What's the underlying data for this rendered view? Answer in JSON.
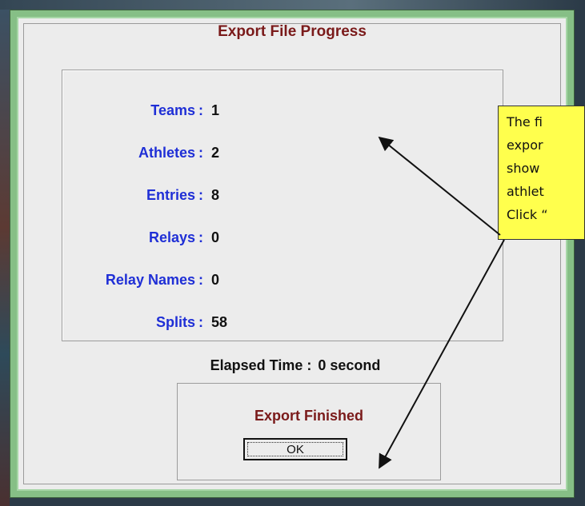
{
  "dialog": {
    "title": "Export File Progress",
    "stats": [
      {
        "label": "Teams",
        "colon": ":",
        "value": "1"
      },
      {
        "label": "Athletes",
        "colon": ":",
        "value": "2"
      },
      {
        "label": "Entries",
        "colon": ":",
        "value": "8"
      },
      {
        "label": "Relays",
        "colon": ":",
        "value": "0"
      },
      {
        "label": "Relay Names",
        "colon": ":",
        "value": "0"
      },
      {
        "label": "Splits",
        "colon": ":",
        "value": "58"
      }
    ],
    "elapsed_label": "Elapsed Time :",
    "elapsed_value": "0 second",
    "status": "Export Finished",
    "ok_label": "OK"
  },
  "callout": {
    "lines": [
      "The fi",
      "expor",
      "show",
      "athlet",
      "Click “"
    ]
  },
  "colors": {
    "title_text": "#7a1a1a",
    "label_text": "#1f2fd6",
    "callout_bg": "#ffff4d",
    "frame_green": "#86bf86"
  }
}
